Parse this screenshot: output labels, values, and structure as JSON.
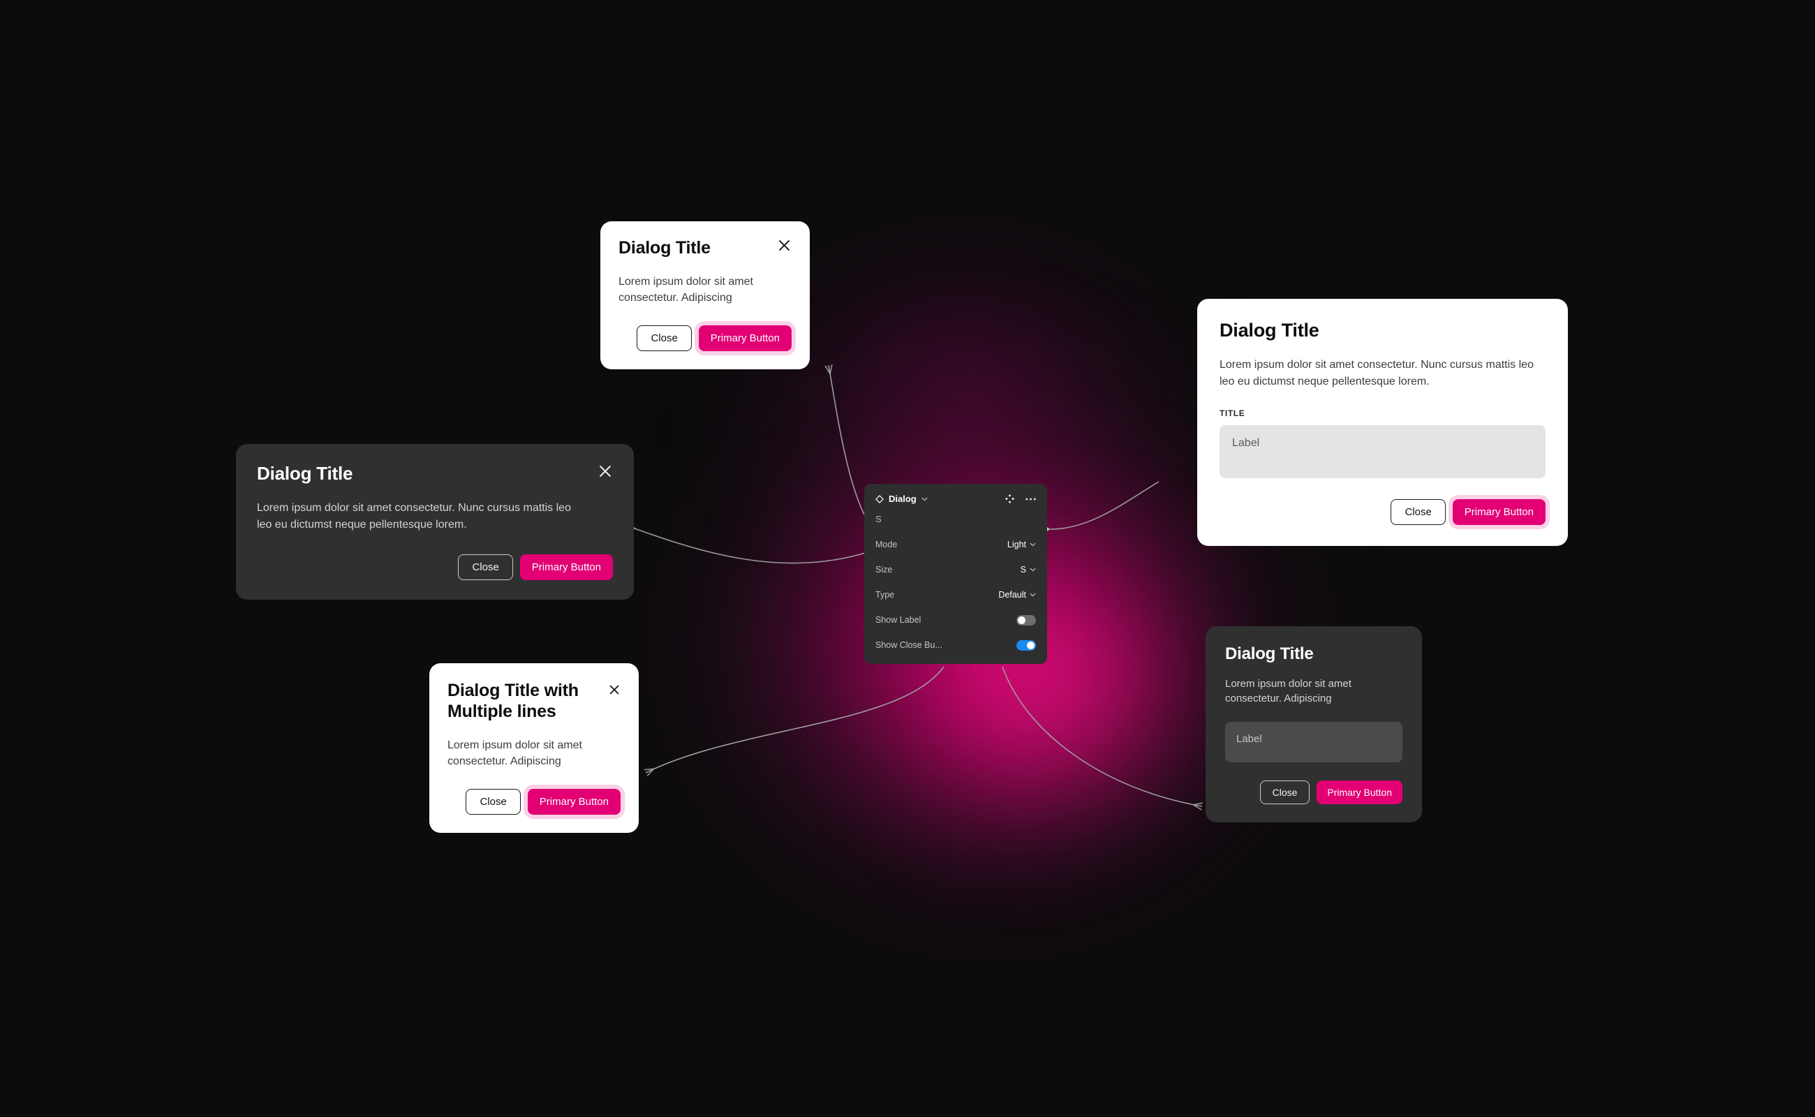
{
  "canvas": {
    "background_color": "#0c0c0d",
    "glow_color": "#e20074"
  },
  "theme": {
    "primary": "#e20074",
    "toggle_on": "#1a8cf0",
    "toggle_off": "#6e6e6e",
    "light_surface": "#ffffff",
    "dark_surface": "#303030",
    "panel_surface": "#2e2e2e"
  },
  "panel": {
    "component_name": "Dialog",
    "variant_label": "S",
    "icons": {
      "component": "component-diamond-icon",
      "chevron": "chevron-down-icon",
      "move": "move-icon",
      "more": "more-options-icon"
    },
    "properties": [
      {
        "label": "Mode",
        "type": "select",
        "value": "Light"
      },
      {
        "label": "Size",
        "type": "select",
        "value": "S"
      },
      {
        "label": "Type",
        "type": "select",
        "value": "Default"
      },
      {
        "label": "Show Label",
        "type": "toggle",
        "value": "off"
      },
      {
        "label": "Show Close Bu...",
        "type": "toggle",
        "value": "on"
      }
    ]
  },
  "dialogs": {
    "top_light_s": {
      "title": "Dialog Title",
      "body": "Lorem ipsum dolor sit amet consectetur. Adipiscing",
      "close_label": "close-icon",
      "secondary_label": "Close",
      "primary_label": "Primary Button"
    },
    "left_dark_m": {
      "title": "Dialog Title",
      "body": "Lorem ipsum dolor sit amet consectetur. Nunc cursus mattis leo leo eu dictumst neque pellentesque lorem.",
      "close_label": "close-icon",
      "secondary_label": "Close",
      "primary_label": "Primary Button"
    },
    "bottom_light_multiline": {
      "title": "Dialog Title with Multiple lines",
      "body": "Lorem ipsum dolor sit amet consectetur. Adipiscing",
      "close_label": "close-icon",
      "secondary_label": "Close",
      "primary_label": "Primary Button"
    },
    "right_light_form": {
      "title": "Dialog Title",
      "body": "Lorem ipsum dolor sit amet consectetur. Nunc cursus mattis leo leo eu dictumst neque pellentesque lorem.",
      "field_label": "TITLE",
      "field_placeholder": "Label",
      "secondary_label": "Close",
      "primary_label": "Primary Button"
    },
    "right_dark_form": {
      "title": "Dialog Title",
      "body": "Lorem ipsum dolor sit amet consectetur. Adipiscing",
      "field_placeholder": "Label",
      "secondary_label": "Close",
      "primary_label": "Primary Button"
    }
  }
}
